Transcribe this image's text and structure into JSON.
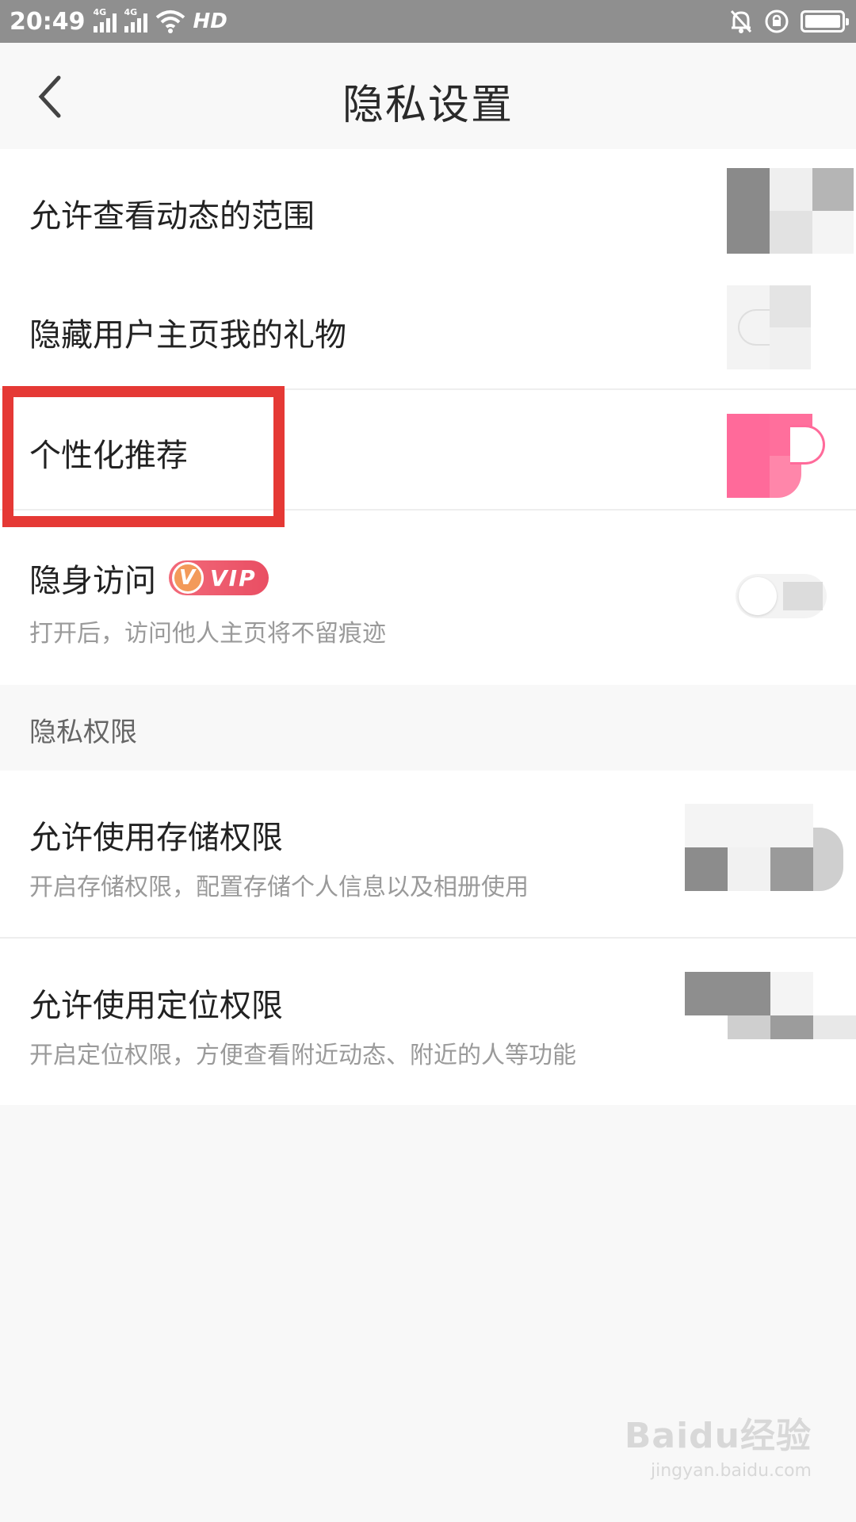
{
  "status_bar": {
    "time": "20:49",
    "network_1": "4G",
    "network_2": "4G",
    "hd_label": "HD"
  },
  "header": {
    "title": "隐私设置"
  },
  "settings": [
    {
      "title": "允许查看动态的范围"
    },
    {
      "title": "隐藏用户主页我的礼物"
    },
    {
      "title": "个性化推荐"
    },
    {
      "title": "隐身访问",
      "badge": "VIP",
      "subtitle": "打开后，访问他人主页将不留痕迹"
    }
  ],
  "section": {
    "title": "隐私权限"
  },
  "permissions": [
    {
      "title": "允许使用存储权限",
      "subtitle": "开启存储权限，配置存储个人信息以及相册使用"
    },
    {
      "title": "允许使用定位权限",
      "subtitle": "开启定位权限，方便查看附近动态、附近的人等功能"
    }
  ],
  "watermark": {
    "main": "Baidu经验",
    "sub": "jingyan.baidu.com"
  },
  "colors": {
    "accent": "#ff6a9a",
    "highlight": "#e53935",
    "status_bar": "#8f8f8f"
  }
}
